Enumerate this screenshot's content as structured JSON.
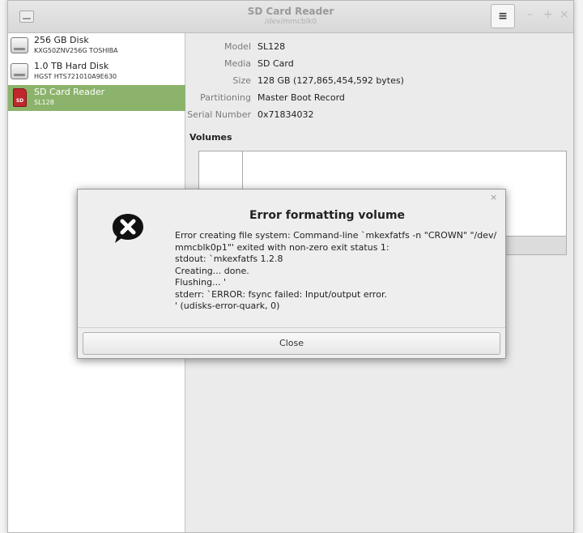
{
  "window": {
    "title": "SD Card Reader",
    "subtitle": "/dev/mmcblk0",
    "menu_icon": "hamburger-menu-icon",
    "minimize": "–",
    "maximize": "+",
    "close": "×"
  },
  "sidebar": {
    "items": [
      {
        "name": "256 GB Disk",
        "sub": "KXG50ZNV256G TOSHIBA",
        "icon": "hard-disk-icon",
        "selected": false
      },
      {
        "name": "1.0 TB Hard Disk",
        "sub": "HGST HTS721010A9E630",
        "icon": "hard-disk-icon",
        "selected": false
      },
      {
        "name": "SD Card Reader",
        "sub": "SL128",
        "icon": "sd-card-icon",
        "icon_label": "SD",
        "selected": true
      }
    ]
  },
  "details": {
    "properties": [
      {
        "label": "Model",
        "value": "SL128"
      },
      {
        "label": "Media",
        "value": "SD Card"
      },
      {
        "label": "Size",
        "value": "128 GB (127,865,454,592 bytes)"
      },
      {
        "label": "Partitioning",
        "value": "Master Boot Record"
      },
      {
        "label": "Serial Number",
        "value": "0x71834032"
      }
    ],
    "volumes_heading": "Volumes"
  },
  "dialog": {
    "title": "Error formatting volume",
    "icon": "error-x-icon",
    "close_x": "×",
    "body_lines": [
      "Error creating file system: Command-line `mkexfatfs -n \"CROWN\" \"/dev/",
      "mmcblk0p1\"' exited with non-zero exit status 1:",
      "stdout: `mkexfatfs 1.2.8",
      "Creating... done.",
      "Flushing... '",
      "stderr: `ERROR: fsync failed: Input/output error.",
      "' (udisks-error-quark, 0)"
    ],
    "close_button": "Close"
  },
  "colors": {
    "selection": "#8cb36b",
    "sd_card": "#c0272d"
  }
}
